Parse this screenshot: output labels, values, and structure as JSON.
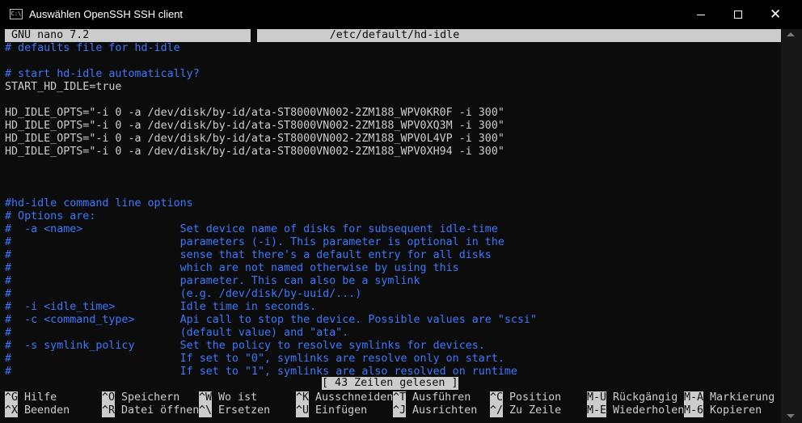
{
  "window": {
    "title": "Auswählen OpenSSH SSH client",
    "icon_label": "C:\\"
  },
  "nano": {
    "version": "GNU nano 7.2",
    "filename": "/etc/default/hd-idle"
  },
  "lines": [
    {
      "text": "# defaults file for hd-idle",
      "comment": true
    },
    {
      "text": "",
      "comment": false
    },
    {
      "text": "# start hd-idle automatically?",
      "comment": true
    },
    {
      "text": "START_HD_IDLE=true",
      "comment": false
    },
    {
      "text": "",
      "comment": false
    },
    {
      "text": "HD_IDLE_OPTS=\"-i 0 -a /dev/disk/by-id/ata-ST8000VN002-2ZM188_WPV0KR0F -i 300\"",
      "comment": false
    },
    {
      "text": "HD_IDLE_OPTS=\"-i 0 -a /dev/disk/by-id/ata-ST8000VN002-2ZM188_WPV0XQ3M -i 300\"",
      "comment": false
    },
    {
      "text": "HD_IDLE_OPTS=\"-i 0 -a /dev/disk/by-id/ata-ST8000VN002-2ZM188_WPV0L4VP -i 300\"",
      "comment": false
    },
    {
      "text": "HD_IDLE_OPTS=\"-i 0 -a /dev/disk/by-id/ata-ST8000VN002-2ZM188_WPV0XH94 -i 300\"",
      "comment": false
    },
    {
      "text": "",
      "comment": false
    },
    {
      "text": "",
      "comment": false
    },
    {
      "text": "",
      "comment": false
    },
    {
      "text": "#hd-idle command line options",
      "comment": true
    },
    {
      "text": "# Options are:",
      "comment": true
    },
    {
      "text": "#  -a <name>               Set device name of disks for subsequent idle-time",
      "comment": true
    },
    {
      "text": "#                          parameters (-i). This parameter is optional in the",
      "comment": true
    },
    {
      "text": "#                          sense that there's a default entry for all disks",
      "comment": true
    },
    {
      "text": "#                          which are not named otherwise by using this",
      "comment": true
    },
    {
      "text": "#                          parameter. This can also be a symlink",
      "comment": true
    },
    {
      "text": "#                          (e.g. /dev/disk/by-uuid/...)",
      "comment": true
    },
    {
      "text": "#  -i <idle_time>          Idle time in seconds.",
      "comment": true
    },
    {
      "text": "#  -c <command_type>       Api call to stop the device. Possible values are \"scsi\"",
      "comment": true
    },
    {
      "text": "#                          (default value) and \"ata\".",
      "comment": true
    },
    {
      "text": "#  -s symlink_policy       Set the policy to resolve symlinks for devices.",
      "comment": true
    },
    {
      "text": "#                          If set to \"0\", symlinks are resolve only on start.",
      "comment": true
    },
    {
      "text": "#                          If set to \"1\", symlinks are also resolved on runtime",
      "comment": true
    }
  ],
  "status_message": "[ 43 Zeilen gelesen ]",
  "shortcuts_row1": [
    {
      "key": "^G",
      "label": "Hilfe"
    },
    {
      "key": "^O",
      "label": "Speichern"
    },
    {
      "key": "^W",
      "label": "Wo ist"
    },
    {
      "key": "^K",
      "label": "Ausschneiden"
    },
    {
      "key": "^T",
      "label": "Ausführen"
    },
    {
      "key": "^C",
      "label": "Position"
    },
    {
      "key": "M-U",
      "label": "Rückgängig"
    },
    {
      "key": "M-A",
      "label": "Markierung"
    }
  ],
  "shortcuts_row2": [
    {
      "key": "^X",
      "label": "Beenden"
    },
    {
      "key": "^R",
      "label": "Datei öffnen"
    },
    {
      "key": "^\\",
      "label": "Ersetzen"
    },
    {
      "key": "^U",
      "label": "Einfügen"
    },
    {
      "key": "^J",
      "label": "Ausrichten"
    },
    {
      "key": "^/",
      "label": "Zu Zeile"
    },
    {
      "key": "M-E",
      "label": "Wiederholen"
    },
    {
      "key": "M-6",
      "label": "Kopieren"
    }
  ],
  "colors": {
    "background": "#0c0c0c",
    "foreground": "#cccccc",
    "comment": "#3b78ff",
    "bar": "#cccccc"
  }
}
